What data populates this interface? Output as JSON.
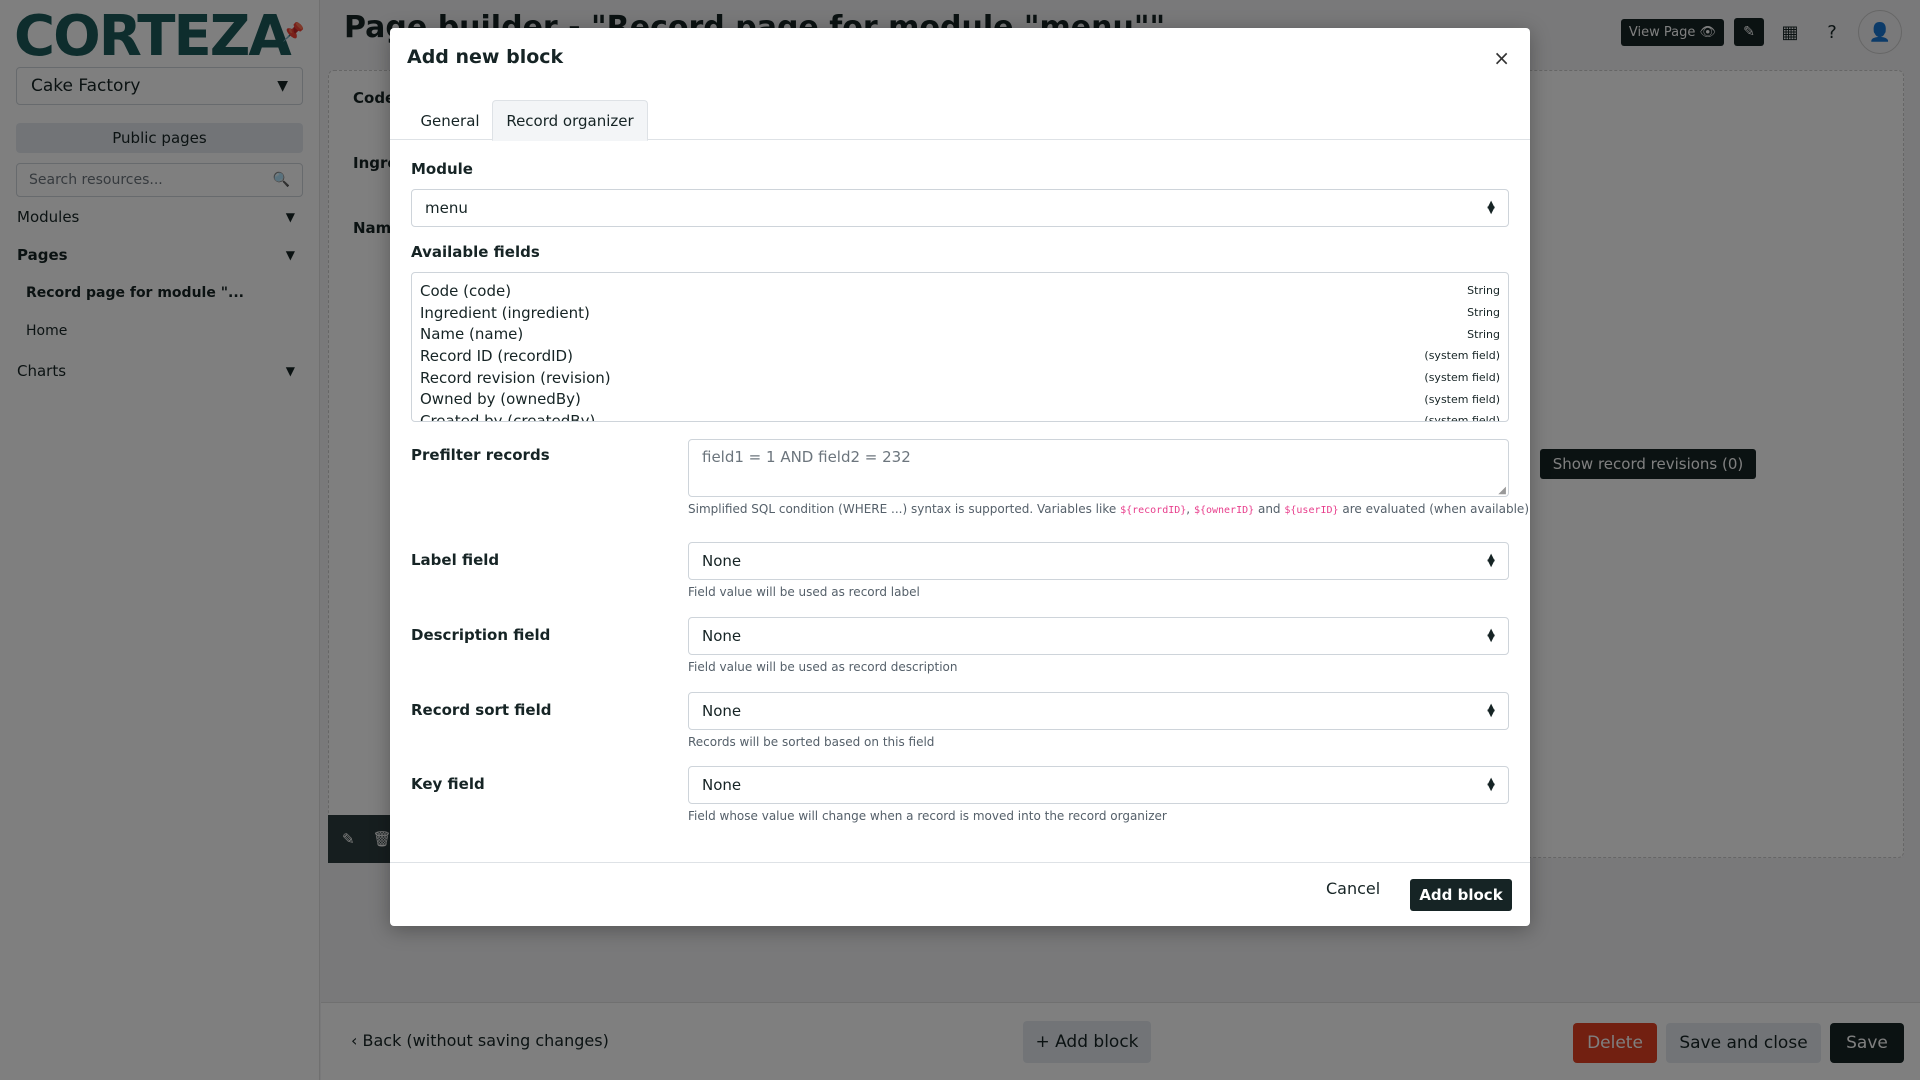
{
  "sidebar": {
    "logo": "CORTEZA",
    "namespace": "Cake Factory",
    "public_pages": "Public pages",
    "search_placeholder": "Search resources...",
    "modules": "Modules",
    "pages": "Pages",
    "page_items": [
      "Record page for module \"...",
      "Home"
    ],
    "charts": "Charts"
  },
  "header": {
    "title": "Page builder - \"Record page for module \"menu\"\"",
    "view_page": "View Page"
  },
  "background": {
    "fields": [
      "Code",
      "Ingred",
      "Name"
    ],
    "show_revisions": "Show record revisions (0)"
  },
  "footer": {
    "back": "Back (without saving changes)",
    "add_block": "+ Add block",
    "delete": "Delete",
    "save_close": "Save and close",
    "save": "Save"
  },
  "modal": {
    "title": "Add new block",
    "tabs": [
      "General",
      "Record organizer"
    ],
    "active_tab": "Record organizer",
    "module_label": "Module",
    "module_value": "menu",
    "available_fields_label": "Available fields",
    "available_fields": [
      {
        "name": "Code (code)",
        "type": "String"
      },
      {
        "name": "Ingredient (ingredient)",
        "type": "String"
      },
      {
        "name": "Name (name)",
        "type": "String"
      },
      {
        "name": "Record ID (recordID)",
        "type": "(system field)"
      },
      {
        "name": "Record revision (revision)",
        "type": "(system field)"
      },
      {
        "name": "Owned by (ownedBy)",
        "type": "(system field)"
      },
      {
        "name": "Created by (createdBy)",
        "type": "(system field)"
      }
    ],
    "prefilter_label": "Prefilter records",
    "prefilter_placeholder": "field1 = 1 AND field2 = 232",
    "prefilter_help_1": "Simplified SQL condition (WHERE ...) syntax is supported. Variables like ",
    "prefilter_var_1": "${recordID}",
    "prefilter_sep_1": ", ",
    "prefilter_var_2": "${ownerID}",
    "prefilter_sep_2": " and ",
    "prefilter_var_3": "${userID}",
    "prefilter_help_2": " are evaluated (when available)",
    "label_field_label": "Label field",
    "label_field_value": "None",
    "label_field_help": "Field value will be used as record label",
    "description_field_label": "Description field",
    "description_field_value": "None",
    "description_field_help": "Field value will be used as record description",
    "sort_field_label": "Record sort field",
    "sort_field_value": "None",
    "sort_field_help": "Records will be sorted based on this field",
    "key_field_label": "Key field",
    "key_field_value": "None",
    "key_field_help": "Field whose value will change when a record is moved into the record organizer",
    "cancel": "Cancel",
    "add_block": "Add block"
  },
  "colors": {
    "primary": "#162425",
    "danger": "#e54122",
    "code_pink": "#e83e8c"
  }
}
